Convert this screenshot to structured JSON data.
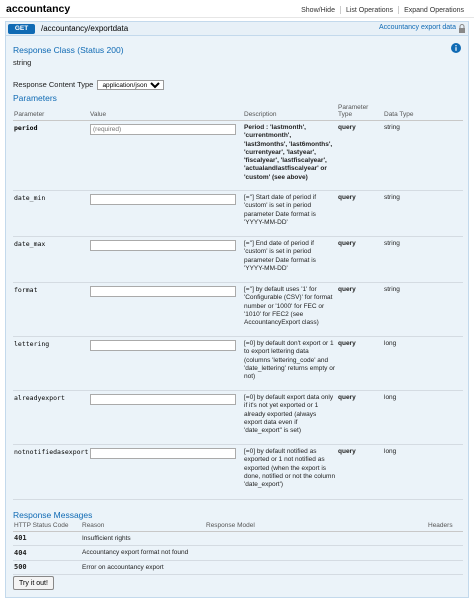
{
  "resource": {
    "title": "accountancy"
  },
  "topnav": [
    "Show/Hide",
    "List Operations",
    "Expand Operations"
  ],
  "operation": {
    "method": "GET",
    "path": "/accountancy/exportdata",
    "summary": "Accountancy export data"
  },
  "response_class": {
    "title": "Response Class (Status 200)",
    "type": "string"
  },
  "content_type": {
    "label": "Response Content Type",
    "selected": "application/json"
  },
  "parameters": {
    "title": "Parameters",
    "headers": {
      "parameter": "Parameter",
      "value": "Value",
      "description": "Description",
      "param_type": "Parameter Type",
      "data_type": "Data Type"
    },
    "rows": [
      {
        "name": "period",
        "placeholder": "(required)",
        "description": "Period : 'lastmonth', 'currentmonth', 'last3months', 'last6months', 'currentyear', 'lastyear', 'fiscalyear', 'lastfiscalyear', 'actualandlastfiscalyear' or 'custom' (see above)",
        "param_type": "query",
        "data_type": "string"
      },
      {
        "name": "date_min",
        "placeholder": "",
        "description": "[=''] Start date of period if 'custom' is set in period parameter Date format is 'YYYY-MM-DD'",
        "param_type": "query",
        "data_type": "string"
      },
      {
        "name": "date_max",
        "placeholder": "",
        "description": "[=''] End date of period if 'custom' is set in period parameter Date format is 'YYYY-MM-DD'",
        "param_type": "query",
        "data_type": "string"
      },
      {
        "name": "format",
        "placeholder": "",
        "description": "[=''] by default uses '1' for 'Configurable (CSV)' for format number or '1000' for FEC or '1010' for FEC2 (see AccountancyExport class)",
        "param_type": "query",
        "data_type": "string"
      },
      {
        "name": "lettering",
        "placeholder": "",
        "description": "[=0] by default don't export or 1 to export lettering data (columns 'lettering_code' and 'date_lettering' returns empty or not)",
        "param_type": "query",
        "data_type": "long"
      },
      {
        "name": "alreadyexport",
        "placeholder": "",
        "description": "[=0] by default export data only if it's not yet exported or 1 already exported (always export data even if 'date_export\" is set)",
        "param_type": "query",
        "data_type": "long"
      },
      {
        "name": "notnotifiedasexport",
        "placeholder": "",
        "description": "[=0] by default notified as exported or 1 not notified as exported (when the export is done, notified or not the column 'date_export')",
        "param_type": "query",
        "data_type": "long"
      }
    ]
  },
  "responses": {
    "title": "Response Messages",
    "headers": {
      "code": "HTTP Status Code",
      "reason": "Reason",
      "model": "Response Model",
      "headers": "Headers"
    },
    "rows": [
      {
        "code": "401",
        "reason": "Insufficient rights"
      },
      {
        "code": "404",
        "reason": "Accountancy export format not found"
      },
      {
        "code": "500",
        "reason": "Error on accountancy export"
      }
    ]
  },
  "try_button": "Try it out!",
  "colors": {
    "get": "#0f6ab4",
    "body_bg": "#ebf3f9",
    "heading_bg": "#e7f0f7"
  }
}
